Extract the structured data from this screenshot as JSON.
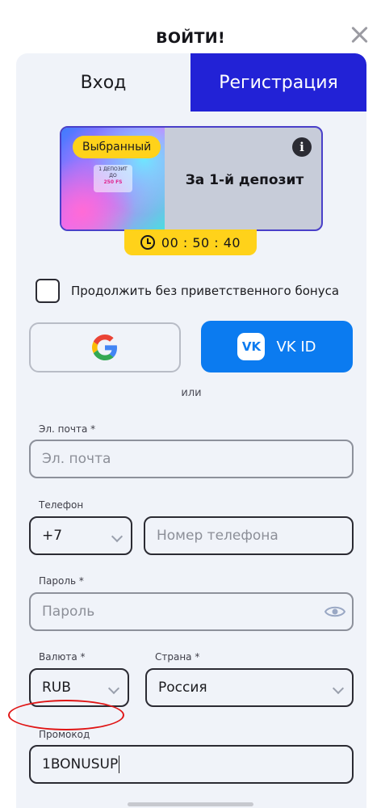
{
  "header": {
    "title": "ВОЙТИ!"
  },
  "tabs": {
    "login": "Вход",
    "register": "Регистрация"
  },
  "bonus": {
    "badge": "Выбранный",
    "tile_line1": "1 ДЕПОЗИТ",
    "tile_line2": "ДО",
    "tile_line3": "250 FS",
    "title": "За 1-й депозит",
    "timer": "00 : 50 : 40"
  },
  "checkbox": {
    "label": "Продолжить без приветственного бонуса",
    "checked": false
  },
  "social": {
    "vk_label": "VK ID",
    "vk_logo": "VK",
    "or": "или"
  },
  "form": {
    "email": {
      "label": "Эл. почта *",
      "placeholder": "Эл. почта"
    },
    "phone": {
      "label": "Телефон",
      "code": "+7",
      "placeholder": "Номер телефона"
    },
    "password": {
      "label": "Пароль *",
      "placeholder": "Пароль"
    },
    "currency": {
      "label": "Валюта *",
      "value": "RUB"
    },
    "country": {
      "label": "Страна *",
      "value": "Россия"
    },
    "promo": {
      "label": "Промокод",
      "value": "1BONUSUP"
    }
  },
  "colors": {
    "accent": "#2222d6",
    "badge": "#ffd21a",
    "vk": "#0b7bf0",
    "highlight": "#e01515"
  },
  "icons": [
    "close-icon",
    "info-icon",
    "clock-icon",
    "google-icon",
    "vk-icon",
    "eye-icon",
    "chevron-down-icon"
  ]
}
